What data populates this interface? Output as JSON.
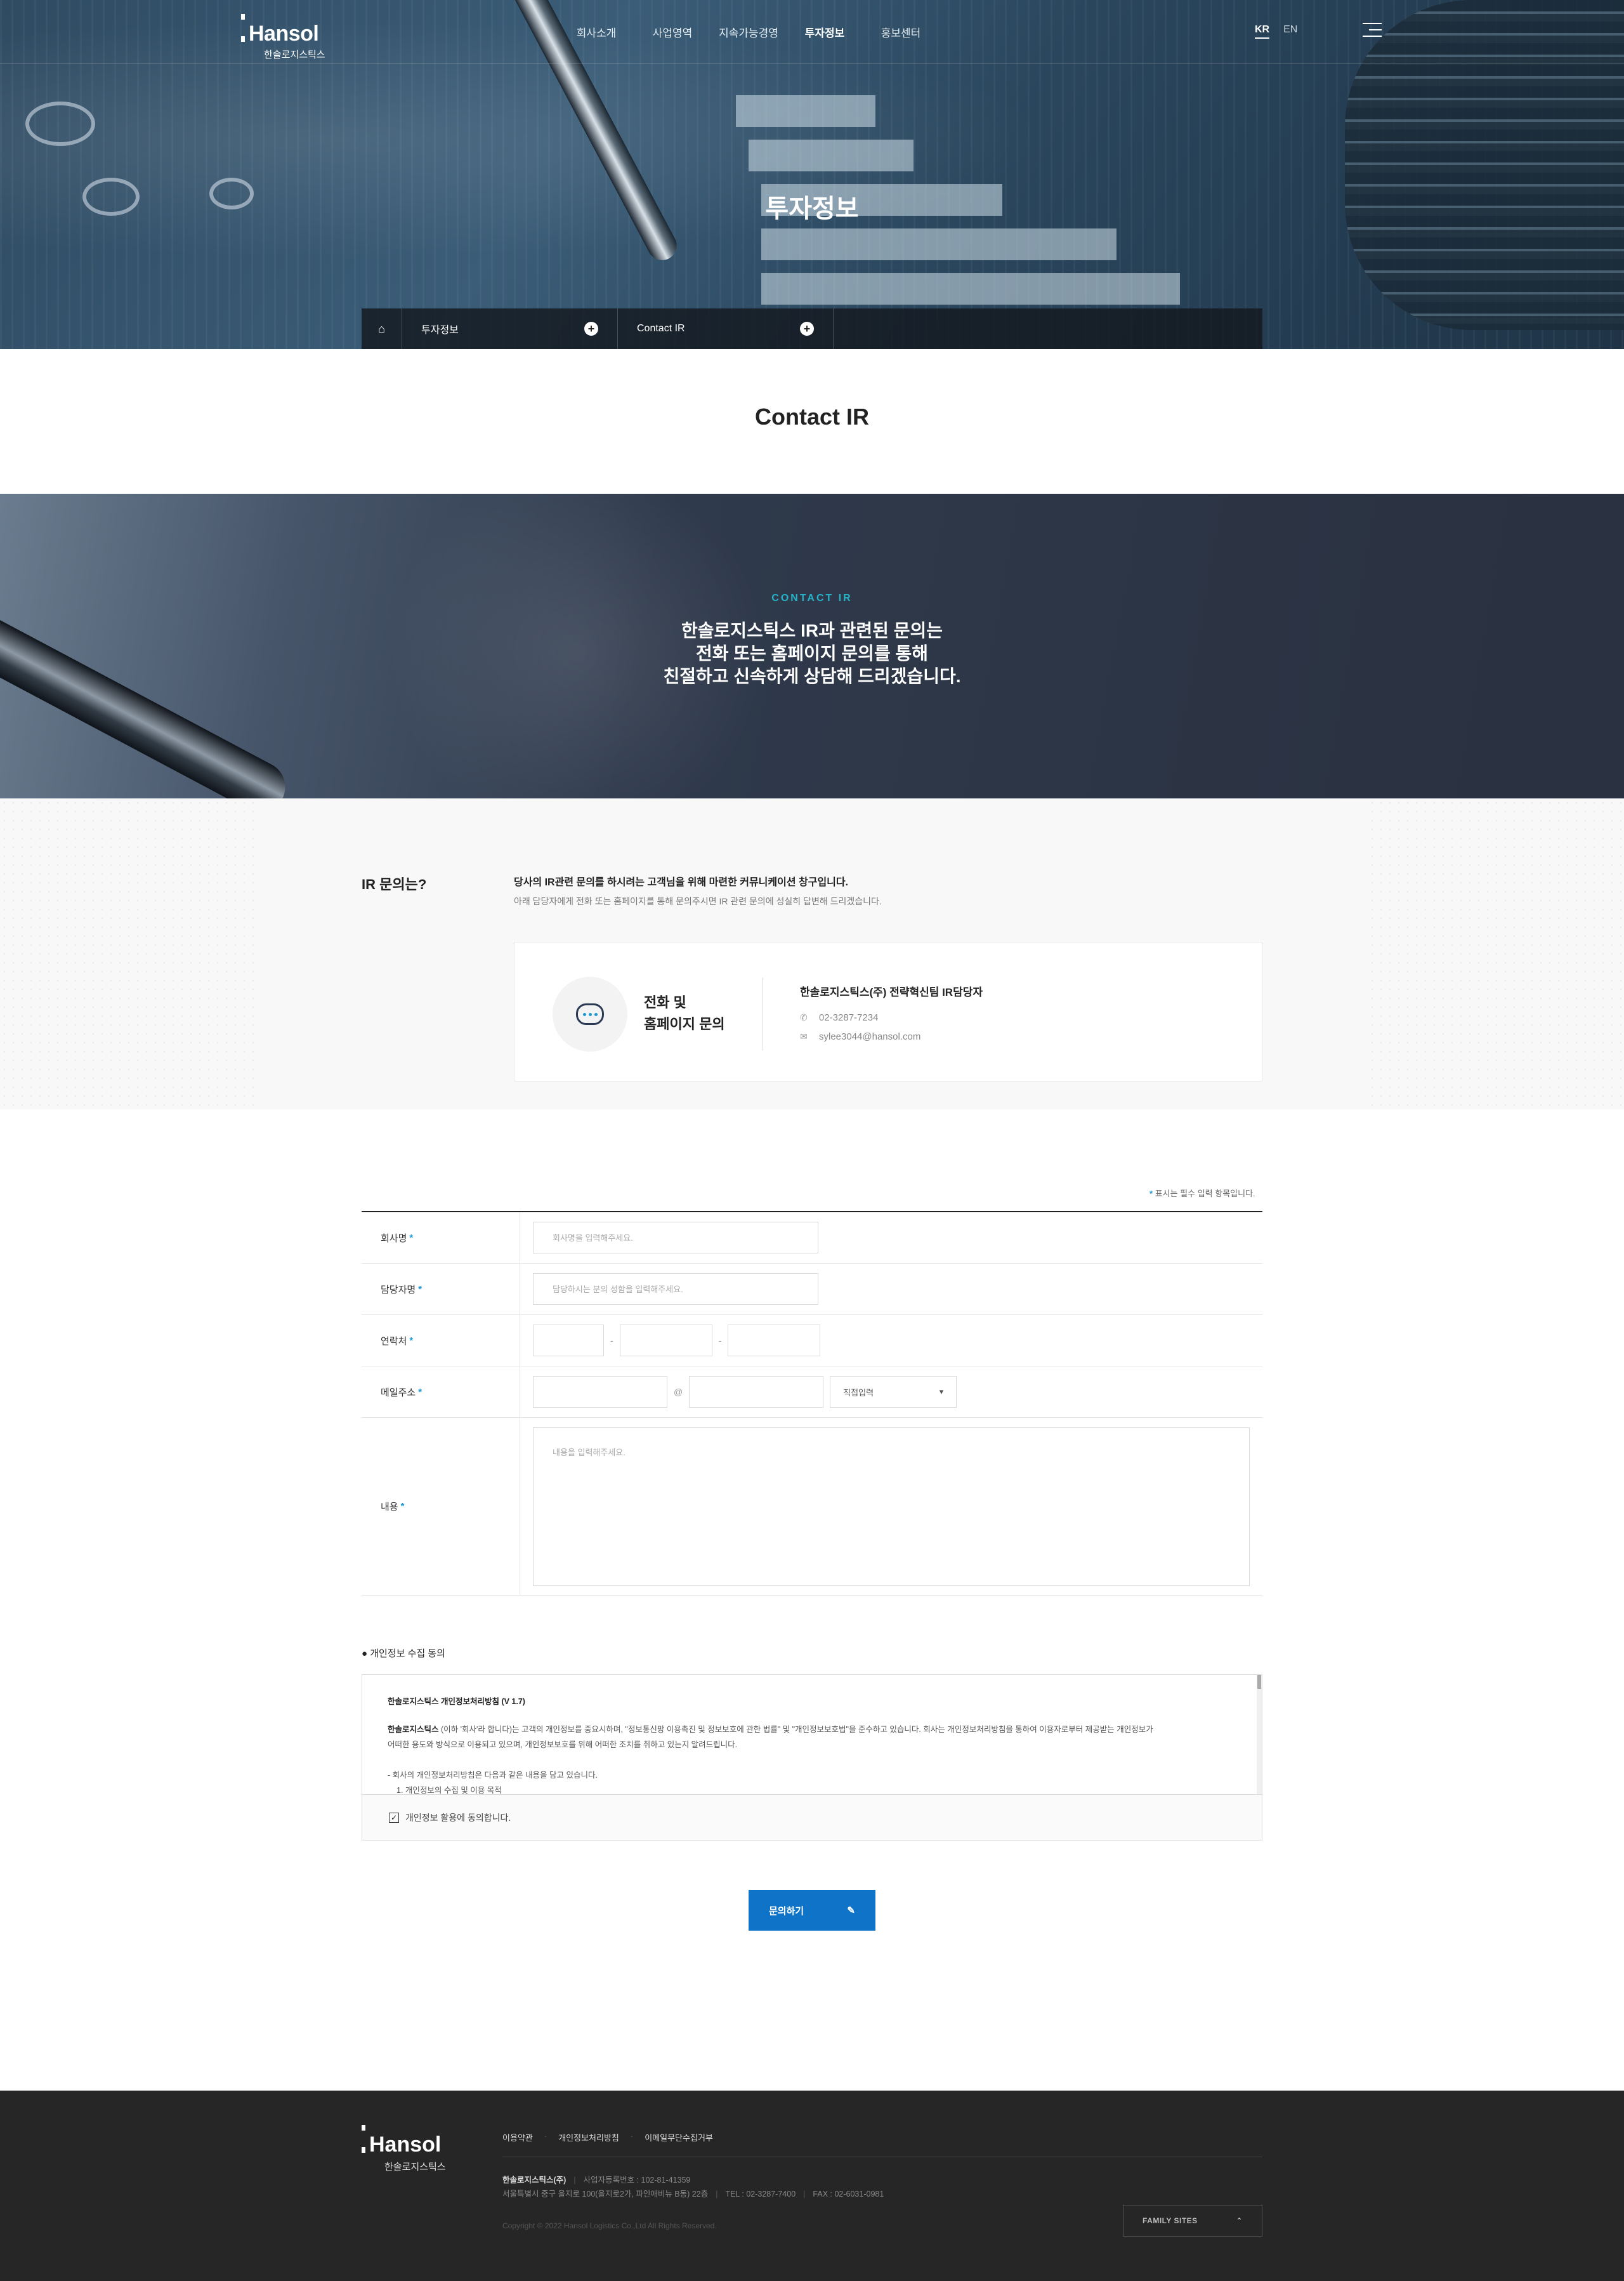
{
  "header": {
    "logo_name": "Hansol",
    "logo_sub": "한솔로지스틱스",
    "nav": [
      "회사소개",
      "사업영역",
      "지속가능경영",
      "투자정보",
      "홍보센터"
    ],
    "active_nav": "투자정보",
    "lang": [
      "KR",
      "EN"
    ],
    "active_lang": "KR"
  },
  "hero": {
    "title": "투자정보",
    "breadcrumb": [
      "투자정보",
      "Contact IR"
    ]
  },
  "page_title": "Contact IR",
  "banner": {
    "kicker": "CONTACT IR",
    "lines": [
      "한솔로지스틱스 IR과 관련된 문의는",
      "전화 또는 홈페이지 문의를 통해",
      "친절하고 신속하게 상담해 드리겠습니다."
    ]
  },
  "ir_info": {
    "heading": "IR 문의는?",
    "lead": "당사의 IR관련 문의를 하시려는 고객님을 위해 마련한 커뮤니케이션 창구입니다.",
    "desc": "아래 담당자에게 전화 또는 홈페이지를 통해 문의주시면 IR 관련 문의에 성실히 답변해 드리겠습니다.",
    "card_title_1": "전화 및",
    "card_title_2": "홈페이지 문의",
    "contact_name": "한솔로지스틱스(주) 전략혁신팀 IR담당자",
    "phone": "02-3287-7234",
    "email": "sylee3044@hansol.com",
    "icon": "speech-bubble-icon"
  },
  "form": {
    "required_note_mark": "*",
    "required_note": "표시는 필수 입력 항목입니다.",
    "company_label": "회사명",
    "company_placeholder": "회사명을 입력해주세요.",
    "manager_label": "담당자명",
    "manager_placeholder": "담당하시는 분의 성함을 입력해주세요.",
    "phone_label": "연락처",
    "phone_sep": "-",
    "email_label": "메일주소",
    "email_at": "@",
    "email_domain_select": "직접입력",
    "content_label": "내용",
    "content_placeholder": "내용을 입력해주세요.",
    "required_mark": "*"
  },
  "privacy": {
    "heading": "● 개인정보 수집 동의",
    "policy_title": "한솔로지스틱스 개인정보처리방침 (V 1.7)",
    "policy_company": "한솔로지스틱스",
    "policy_p1": "(이하 '회사'라 합니다)는 고객의 개인정보를 중요시하며, \"정보통신망 이용촉진 및 정보보호에 관한 법률\" 및 \"개인정보보호법\"을 준수하고 있습니다. 회사는 개인정보처리방침을 통하여 이용자로부터 제공받는 개인정보가",
    "policy_p2": "어떠한 용도와 방식으로 이용되고 있으며, 개인정보보호를 위해 어떠한 조치를 취하고 있는지 알려드립니다.",
    "policy_p3": "- 회사의 개인정보처리방침은 다음과 같은 내용을 담고 있습니다.",
    "policy_p4": "1. 개인정보의 수집 및 이용 목적",
    "agree_label": "개인정보 활용에 동의합니다.",
    "agree_checked": true
  },
  "submit_label": "문의하기",
  "footer": {
    "links": [
      "이용약관",
      "개인정보처리방침",
      "이메일무단수집거부"
    ],
    "company": "한솔로지스틱스(주)",
    "biz_no": "사업자등록번호 : 102-81-41359",
    "address": "서울특별시 중구 을지로 100(을지로2가, 파인애비뉴 B동) 22층",
    "tel": "TEL : 02-3287-7400",
    "fax": "FAX : 02-6031-0981",
    "copyright": "Copyright © 2022 Hansol Logistics Co.,Ltd All Rights Reserved.",
    "family_sites": "FAMILY SITES"
  },
  "colors": {
    "accent": "#0f73c8",
    "kicker": "#25b3c8",
    "required": "#1b9ad6",
    "footer_bg": "#262626"
  }
}
